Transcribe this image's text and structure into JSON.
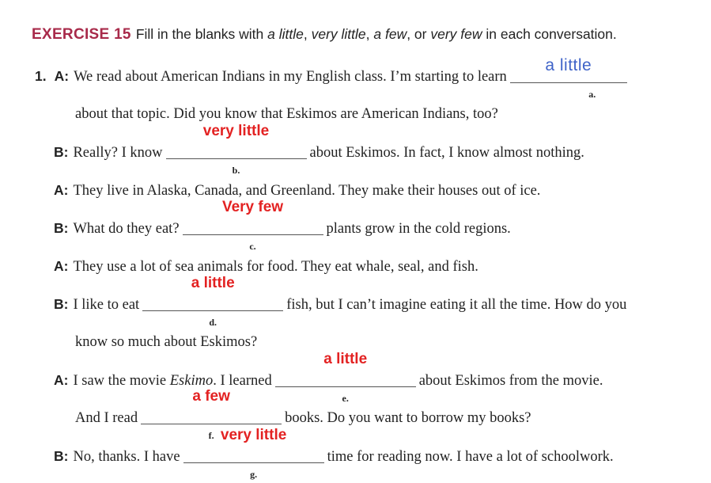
{
  "header": {
    "exercise_label": "EXERCISE 15",
    "instr_1": "Fill in the blanks with ",
    "opt_a_little": "a little",
    "comma1": ", ",
    "opt_very_little": "very little",
    "comma2": ", ",
    "opt_a_few": "a few",
    "or": ", or ",
    "opt_very_few": "very few",
    "instr_2": " in each conversation."
  },
  "number": "1.",
  "speakers": {
    "a": "A:",
    "b": "B:"
  },
  "lines": {
    "l1_text": "We read about American Indians in my English class. I’m starting to learn",
    "l2_text": "about that topic. Did you know that Eskimos are American Indians, too?",
    "l3_pre": "Really? I know",
    "l3_post": "about Eskimos. In fact, I know almost nothing.",
    "l4_text": "They live in Alaska, Canada, and Greenland. They make their houses out of ice.",
    "l5_pre": "What do they eat?",
    "l5_post": "plants grow in the cold regions.",
    "l6_text": "They use a lot of sea animals for food. They eat whale, seal, and fish.",
    "l7_pre": "I like to eat",
    "l7_post": "fish, but I can’t imagine eating it all the time. How do you",
    "l8_text": "know so much about Eskimos?",
    "l9_pre": "I saw the movie ",
    "l9_movie": "Eskimo",
    "l9_mid": ". I learned",
    "l9_post": "about Eskimos from the movie.",
    "l10_pre": "And I read",
    "l10_post": "books. Do you want to borrow my books?",
    "l11_pre": "No, thanks. I have",
    "l11_post": "time for reading now. I have a lot of schoolwork."
  },
  "blanks": [
    {
      "letter": "a.",
      "answer": "a little"
    },
    {
      "letter": "b.",
      "answer": "very little"
    },
    {
      "letter": "c.",
      "answer": "Very few"
    },
    {
      "letter": "d.",
      "answer": "a little"
    },
    {
      "letter": "e.",
      "answer": "a little"
    },
    {
      "letter": "f.",
      "answer": "a few"
    },
    {
      "letter": "g.",
      "answer": "very little"
    }
  ],
  "colors": {
    "exercise_label": "#a82a4a",
    "answer": "#e32222",
    "handwritten_answer": "#3f63c8"
  }
}
